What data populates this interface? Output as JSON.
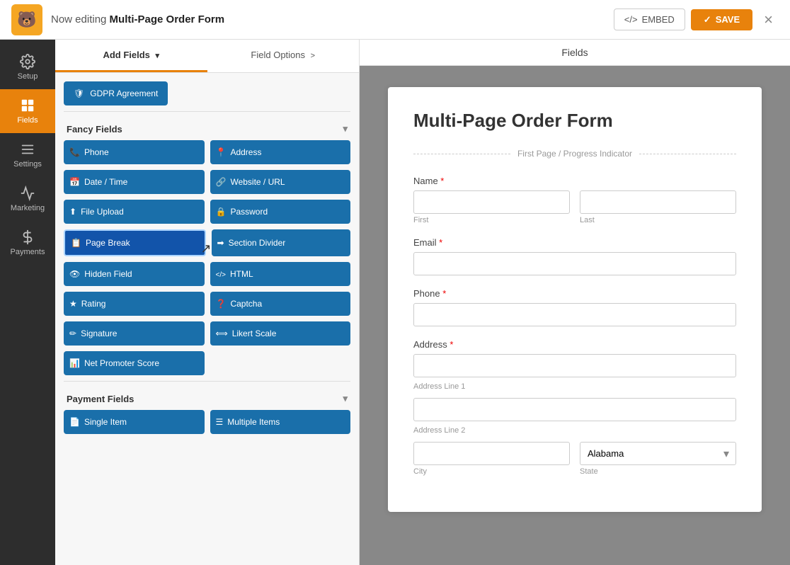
{
  "app": {
    "logo": "🐻",
    "header": {
      "editing_prefix": "Now editing ",
      "form_name": "Multi-Page Order Form",
      "embed_label": "EMBED",
      "save_label": "SAVE",
      "close_label": "×"
    }
  },
  "sidebar": {
    "items": [
      {
        "id": "setup",
        "label": "Setup",
        "icon": "⚙"
      },
      {
        "id": "fields",
        "label": "Fields",
        "icon": "▦",
        "active": true
      },
      {
        "id": "settings",
        "label": "Settings",
        "icon": "≡"
      },
      {
        "id": "marketing",
        "label": "Marketing",
        "icon": "📣"
      },
      {
        "id": "payments",
        "label": "Payments",
        "icon": "$"
      }
    ]
  },
  "middle_panel": {
    "tabs": [
      {
        "id": "add-fields",
        "label": "Add Fields",
        "active": true,
        "arrow": "▾"
      },
      {
        "id": "field-options",
        "label": "Field Options",
        "active": false,
        "arrow": ">"
      }
    ],
    "sections": [
      {
        "id": "fancy-fields",
        "label": "Fancy Fields",
        "expanded": true,
        "fields_before": [
          {
            "id": "gdpr",
            "label": "GDPR Agreement",
            "icon": "gdpr"
          }
        ],
        "fields": [
          {
            "id": "phone",
            "label": "Phone",
            "icon": "phone"
          },
          {
            "id": "address",
            "label": "Address",
            "icon": "address"
          },
          {
            "id": "datetime",
            "label": "Date / Time",
            "icon": "datetime"
          },
          {
            "id": "website",
            "label": "Website / URL",
            "icon": "website"
          },
          {
            "id": "file-upload",
            "label": "File Upload",
            "icon": "upload"
          },
          {
            "id": "password",
            "label": "Password",
            "icon": "password"
          },
          {
            "id": "page-break",
            "label": "Page Break",
            "icon": "pagebreak",
            "active": true
          },
          {
            "id": "section-divider",
            "label": "Section Divider",
            "icon": "divider"
          },
          {
            "id": "hidden-field",
            "label": "Hidden Field",
            "icon": "hidden"
          },
          {
            "id": "html",
            "label": "HTML",
            "icon": "html"
          },
          {
            "id": "rating",
            "label": "Rating",
            "icon": "rating"
          },
          {
            "id": "captcha",
            "label": "Captcha",
            "icon": "captcha"
          },
          {
            "id": "signature",
            "label": "Signature",
            "icon": "signature"
          },
          {
            "id": "likert-scale",
            "label": "Likert Scale",
            "icon": "likert"
          },
          {
            "id": "nps",
            "label": "Net Promoter Score",
            "icon": "nps"
          }
        ]
      },
      {
        "id": "payment-fields",
        "label": "Payment Fields",
        "expanded": false,
        "fields": [
          {
            "id": "single-item",
            "label": "Single Item",
            "icon": "single"
          },
          {
            "id": "multiple-items",
            "label": "Multiple Items",
            "icon": "multiple"
          }
        ]
      }
    ]
  },
  "fields_tab_label": "Fields",
  "form_preview": {
    "title": "Multi-Page Order Form",
    "page_indicator": "First Page / Progress Indicator",
    "fields": [
      {
        "id": "name",
        "label": "Name",
        "required": true,
        "type": "name",
        "subfields": [
          {
            "id": "first",
            "placeholder": "",
            "sublabel": "First"
          },
          {
            "id": "last",
            "placeholder": "",
            "sublabel": "Last"
          }
        ]
      },
      {
        "id": "email",
        "label": "Email",
        "required": true,
        "type": "text",
        "placeholder": ""
      },
      {
        "id": "phone",
        "label": "Phone",
        "required": true,
        "type": "text",
        "placeholder": ""
      },
      {
        "id": "address",
        "label": "Address",
        "required": true,
        "type": "address",
        "subfields": [
          {
            "id": "line1",
            "placeholder": "",
            "sublabel": "Address Line 1"
          },
          {
            "id": "line2",
            "placeholder": "",
            "sublabel": "Address Line 2"
          },
          {
            "id": "city",
            "placeholder": "",
            "sublabel": "City"
          },
          {
            "id": "state",
            "value": "Alabama",
            "sublabel": "State",
            "type": "select"
          }
        ]
      }
    ]
  }
}
